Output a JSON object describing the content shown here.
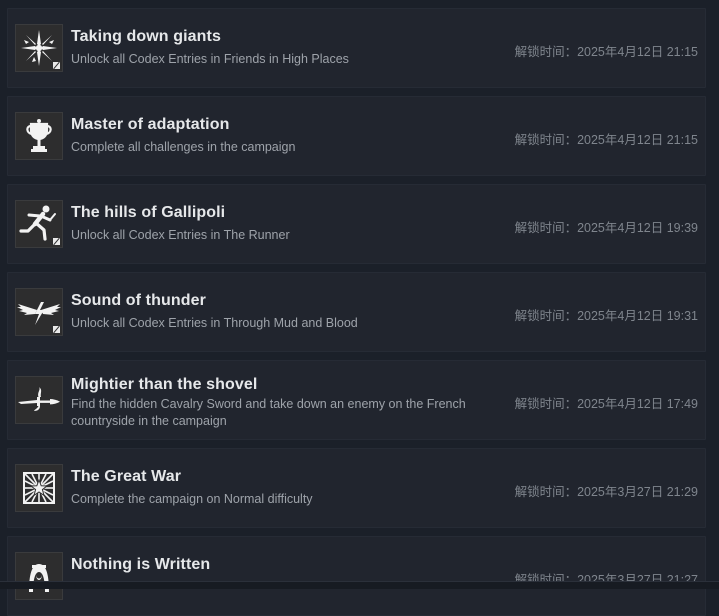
{
  "date_prefix": "解锁时间：",
  "achievements": [
    {
      "icon": "shattered-star-icon",
      "title": "Taking down giants",
      "description": "Unlock all Codex Entries in Friends in High Places",
      "unlock_time": "解锁时间：2025年4月12日 21:15",
      "badge": true
    },
    {
      "icon": "trophy-icon",
      "title": "Master of adaptation",
      "description": "Complete all challenges in the campaign",
      "unlock_time": "解锁时间：2025年4月12日 21:15",
      "badge": false
    },
    {
      "icon": "runner-icon",
      "title": "The hills of Gallipoli",
      "description": "Unlock all Codex Entries in The Runner",
      "unlock_time": "解锁时间：2025年4月12日 19:39",
      "badge": true
    },
    {
      "icon": "winged-lightning-icon",
      "title": "Sound of thunder",
      "description": "Unlock all Codex Entries in Through Mud and Blood",
      "unlock_time": "解锁时间：2025年4月12日 19:31",
      "badge": true
    },
    {
      "icon": "sword-icon",
      "title": "Mightier than the shovel",
      "description": "Find the hidden Cavalry Sword and take down an enemy on the French countryside in the campaign",
      "unlock_time": "解锁时间：2025年4月12日 17:49",
      "badge": false
    },
    {
      "icon": "star-burst-icon",
      "title": "The Great War",
      "description": "Complete the campaign on Normal difficulty",
      "unlock_time": "解锁时间：2025年3月27日 21:29",
      "badge": false
    },
    {
      "icon": "bedouin-portrait-icon",
      "title": "Nothing is Written",
      "description": "",
      "unlock_time": "解锁时间：2025年3月27日 21:27",
      "badge": false
    }
  ]
}
